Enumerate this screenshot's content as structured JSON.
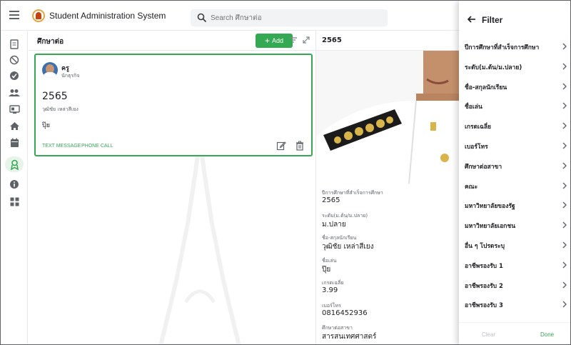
{
  "app": {
    "title": "Student Administration System"
  },
  "search": {
    "placeholder": "Search ศึกษาต่อ"
  },
  "list": {
    "title": "ศึกษาต่อ",
    "add_label": "Add"
  },
  "card": {
    "role": "ครู",
    "role_sub": "นักธุรกิจ",
    "year": "2565",
    "name": "วุฒิชัย เหล่าสีเยง",
    "nickname": "ปุ๊ย",
    "action_text": "TEXT MESSAGE",
    "action_call": "PHONE CALL"
  },
  "detail": {
    "header_year": "2565",
    "fields": [
      {
        "label": "ปีการศึกษาที่สำเร็จการศึกษา",
        "value": "2565"
      },
      {
        "label": "ระดับ(ม.ต้น/ม.ปลาย)",
        "value": "ม.ปลาย"
      },
      {
        "label": "ชื่อ-สกุลนักเรียน",
        "value": "วุฒิชัย เหล่าสีเยง"
      },
      {
        "label": "ชื่อเล่น",
        "value": "ปุ๊ย"
      },
      {
        "label": "เกรดเฉลี่ย",
        "value": "3.99"
      },
      {
        "label": "เบอร์โทร",
        "value": "0816452936"
      },
      {
        "label": "ศึกษาต่อสาขา",
        "value": "สารสนเทศศาสตร์"
      }
    ]
  },
  "filter": {
    "title": "Filter",
    "items": [
      "ปีการศึกษาที่สำเร็จการศึกษา",
      "ระดับ(ม.ต้น/ม.ปลาย)",
      "ชื่อ-สกุลนักเรียน",
      "ชื่อเล่น",
      "เกรดเฉลี่ย",
      "เบอร์โทร",
      "ศึกษาต่อสาขา",
      "คณะ",
      "มหาวิทยาลัยของรัฐ",
      "มหาวิทยาลัยเอกชน",
      "อื่น ๆ โปรดระบุ",
      "อาชีพรองรับ 1",
      "อาชีพรองรับ 2",
      "อาชีพรองรับ 3"
    ],
    "clear_label": "Clear",
    "done_label": "Done"
  },
  "colors": {
    "accent": "#34a853",
    "active_rail": "#e6f4ea",
    "text": "#202124",
    "muted": "#5f6368"
  },
  "icons": {
    "rail": [
      "document-icon",
      "block-icon",
      "check-circle-icon",
      "people-icon",
      "id-card-icon",
      "home-icon",
      "calendar-icon",
      "graduation-icon",
      "info-icon",
      "grid-icon"
    ]
  }
}
